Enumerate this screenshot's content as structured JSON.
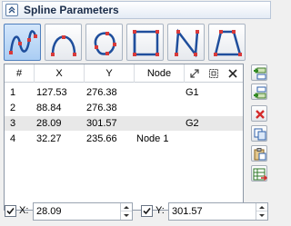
{
  "panel": {
    "title": "Spline Parameters"
  },
  "tools": [
    {
      "name": "spline-through-points"
    },
    {
      "name": "arc-spline"
    },
    {
      "name": "closed-spline"
    },
    {
      "name": "closed-polyline"
    },
    {
      "name": "open-polyline"
    },
    {
      "name": "closed-polygon"
    }
  ],
  "table": {
    "headers": {
      "index": "#",
      "x": "X",
      "y": "Y",
      "node": "Node"
    },
    "rows": [
      {
        "index": "1",
        "x": "127.53",
        "y": "276.38",
        "node": "",
        "extra": "G1"
      },
      {
        "index": "2",
        "x": "88.84",
        "y": "276.38",
        "node": "",
        "extra": ""
      },
      {
        "index": "3",
        "x": "28.09",
        "y": "301.57",
        "node": "",
        "extra": "G2"
      },
      {
        "index": "4",
        "x": "32.27",
        "y": "235.66",
        "node": "Node 1",
        "extra": ""
      }
    ],
    "selected_row": 3
  },
  "footer": {
    "x_label": "X:",
    "x_value": "28.09",
    "y_label": "Y:",
    "y_value": "301.57"
  },
  "colors": {
    "accent": "#1f5fb5",
    "point": "#d83a3a",
    "selection": "#e8e8e8"
  }
}
